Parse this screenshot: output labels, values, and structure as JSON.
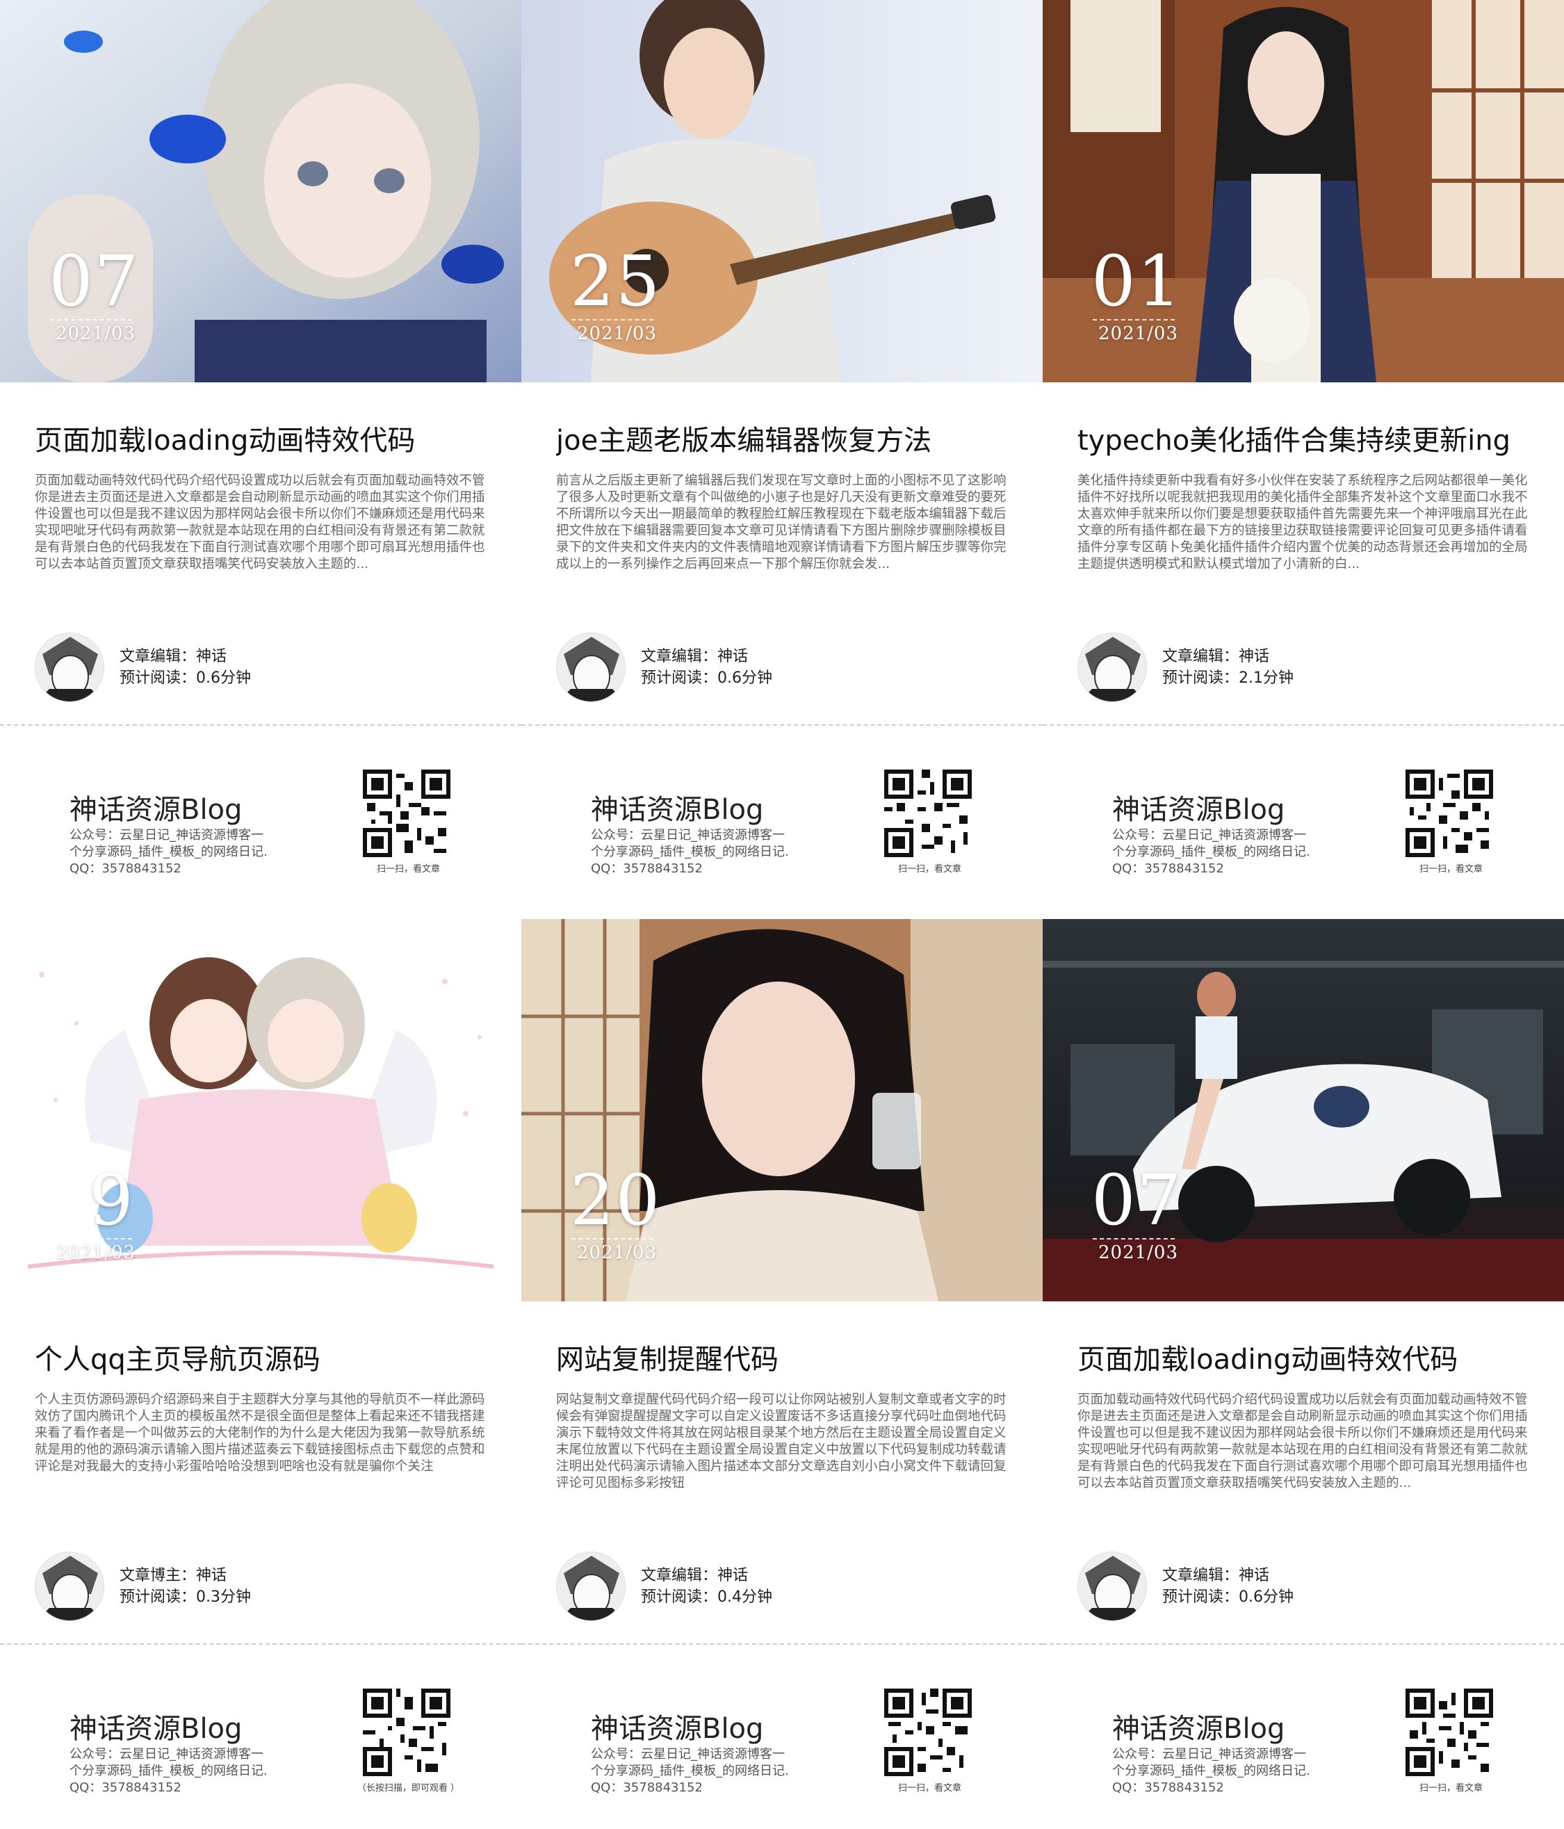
{
  "cards": [
    {
      "date_day": "07",
      "date_ym": "2021/03",
      "title": "页面加载loading动画特效代码",
      "excerpt": "页面加载动画特效代码代码介绍代码设置成功以后就会有页面加载动画特效不管你是进去主页面还是进入文章都是会自动刷新显示动画的喷血其实这个你们用插件设置也可以但是我不建议因为那样网站会很卡所以你们不嫌麻烦还是用代码来实现吧呲牙代码有两款第一款就是本站现在用的白红相间没有背景还有第二款就是有背景白色的代码我发在下面自行测试喜欢哪个用哪个即可扇耳光想用插件也可以去本站首页置顶文章获取捂嘴笑代码安装放入主题的...",
      "meta_author": "文章编辑：神话",
      "meta_read": "预计阅读：0.6分钟",
      "promo_title": "神话资源Blog",
      "promo_desc": [
        "公众号：云星日记_神话资源博客一",
        "个分享源码_插件_模板_的网络日记.",
        "QQ：3578843152"
      ],
      "qr_caption": "扫一扫，看文章"
    },
    {
      "date_day": "25",
      "date_ym": "2021/03",
      "title": "joe主题老版本编辑器恢复方法",
      "excerpt": "前言从之后版主更新了编辑器后我们发现在写文章时上面的小图标不见了这影响了很多人及时更新文章有个叫做绝的小崽子也是好几天没有更新文章难受的要死不所谓所以今天出一期最简单的教程脸红解压教程现在下载老版本编辑器下载后把文件放在下编辑器需要回复本文章可见详情请看下方图片删除步骤删除模板目录下的文件夹和文件夹内的文件表情暗地观察详情请看下方图片解压步骤等你完成以上的一系列操作之后再回来点一下那个解压你就会发...",
      "meta_author": "文章编辑：神话",
      "meta_read": "预计阅读：0.6分钟",
      "promo_title": "神话资源Blog",
      "promo_desc": [
        "公众号：云星日记_神话资源博客一",
        "个分享源码_插件_模板_的网络日记.",
        "QQ：3578843152"
      ],
      "qr_caption": "扫一扫，看文章"
    },
    {
      "date_day": "01",
      "date_ym": "2021/03",
      "title": "typecho美化插件合集持续更新ing",
      "excerpt": "美化插件持续更新中我看有好多小伙伴在安装了系统程序之后网站都很单一美化插件不好找所以呢我就把我现用的美化插件全部集齐发补这个文章里面口水我不太喜欢伸手就来所以你们要是想要获取插件首先需要先来一个神评哦扇耳光在此文章的所有插件都在最下方的链接里边获取链接需要评论回复可见更多插件请看插件分享专区萌卜兔美化插件插件介绍内置个优美的动态背景还会再增加的全局主题提供透明模式和默认模式增加了小清新的白...",
      "meta_author": "文章编辑：神话",
      "meta_read": "预计阅读：2.1分钟",
      "promo_title": "神话资源Blog",
      "promo_desc": [
        "公众号：云星日记_神话资源博客一",
        "个分享源码_插件_模板_的网络日记.",
        "QQ：3578843152"
      ],
      "qr_caption": "扫一扫，看文章"
    },
    {
      "date_day": "9",
      "date_ym": "2021/03",
      "title": "个人qq主页导航页源码",
      "excerpt": "个人主页仿源码源码介绍源码来自于主题群大分享与其他的导航页不一样此源码效仿了国内腾讯个人主页的模板虽然不是很全面但是整体上看起来还不错我搭建来看了看作者是一个叫做苏云的大佬制作的为什么是大佬因为我第一款导航系统就是用的他的源码演示请输入图片描述蓝奏云下载链接图标点击下载您的点赞和评论是对我最大的支持小彩蛋哈哈哈没想到吧啥也没有就是骗你个关注",
      "meta_author": "文章博主：神话",
      "meta_read": "预计阅读：0.3分钟",
      "promo_title": "神话资源Blog",
      "promo_desc": [
        "公众号：云星日记_神话资源博客一",
        "个分享源码_插件_模板_的网络日记.",
        "QQ：3578843152"
      ],
      "qr_caption": "（长按扫描，即可观看 ）"
    },
    {
      "date_day": "20",
      "date_ym": "2021/03",
      "title": "网站复制提醒代码",
      "excerpt": "网站复制文章提醒代码代码介绍一段可以让你网站被别人复制文章或者文字的时候会有弹窗提醒提醒文字可以自定义设置废话不多话直接分享代码吐血倒地代码演示下载特效文件将其放在网站根目录某个地方然后在主题设置全局设置自定义末尾位放置以下代码在主题设置全局设置自定义中放置以下代码复制成功转载请注明出处代码演示请输入图片描述本文部分文章选自刘小白小窝文件下载请回复评论可见图标多彩按钮",
      "meta_author": "文章编辑：神话",
      "meta_read": "预计阅读：0.4分钟",
      "promo_title": "神话资源Blog",
      "promo_desc": [
        "公众号：云星日记_神话资源博客一",
        "个分享源码_插件_模板_的网络日记.",
        "QQ：3578843152"
      ],
      "qr_caption": "扫一扫，看文章"
    },
    {
      "date_day": "07",
      "date_ym": "2021/03",
      "title": "页面加载loading动画特效代码",
      "excerpt": "页面加载动画特效代码代码介绍代码设置成功以后就会有页面加载动画特效不管你是进去主页面还是进入文章都是会自动刷新显示动画的喷血其实这个你们用插件设置也可以但是我不建议因为那样网站会很卡所以你们不嫌麻烦还是用代码来实现吧呲牙代码有两款第一款就是本站现在用的白红相间没有背景还有第二款就是有背景白色的代码我发在下面自行测试喜欢哪个用哪个即可扇耳光想用插件也可以去本站首页置顶文章获取捂嘴笑代码安装放入主题的...",
      "meta_author": "文章编辑：神话",
      "meta_read": "预计阅读：0.6分钟",
      "promo_title": "神话资源Blog",
      "promo_desc": [
        "公众号：云星日记_神话资源博客一",
        "个分享源码_插件_模板_的网络日记.",
        "QQ：3578843152"
      ],
      "qr_caption": "扫一扫，看文章"
    }
  ]
}
